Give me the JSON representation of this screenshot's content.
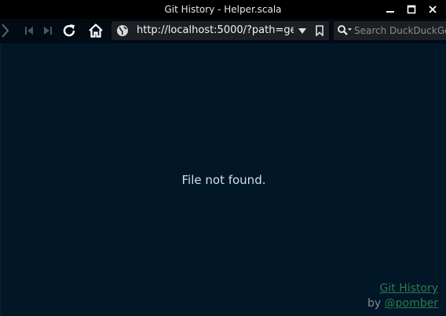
{
  "window": {
    "title": "Git History - Helper.scala"
  },
  "toolbar": {
    "url": "http://localhost:5000/?path=ge...",
    "search_placeholder": "Search DuckDuckGo"
  },
  "icons": {
    "forward": "chevron-right-icon",
    "first": "skip-back-icon",
    "last": "skip-forward-icon",
    "reload": "reload-icon",
    "home": "home-icon",
    "globe": "globe-icon",
    "dropdown": "dropdown-arrow-icon",
    "bookmark": "bookmark-icon",
    "search": "search-icon"
  },
  "main": {
    "message": "File not found."
  },
  "footer": {
    "link_text": "Git History",
    "by_text": "by ",
    "author_text": "@pomber"
  },
  "colors": {
    "background": "#011627",
    "toolbar": "#020b14",
    "titlebar": "#000000",
    "link": "#2f7a4c",
    "text": "#d6deeb"
  }
}
